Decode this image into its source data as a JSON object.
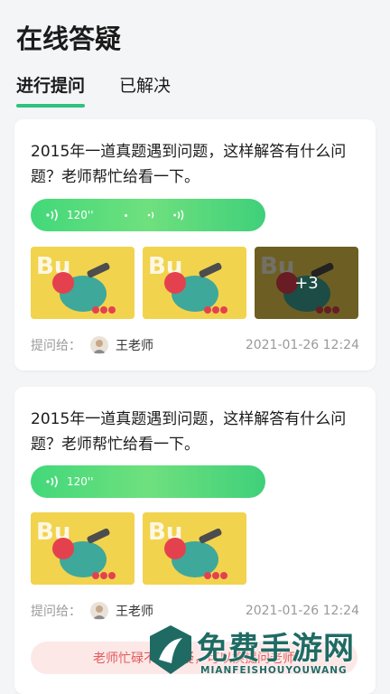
{
  "header": {
    "title": "在线答疑"
  },
  "tabs": [
    {
      "label": "进行提问",
      "active": true
    },
    {
      "label": "已解决",
      "active": false
    }
  ],
  "cards": [
    {
      "question": "2015年一道真题遇到问题，这样解答有什么问题？老师帮忙给看一下。",
      "audio_duration": "120''",
      "extra_images": "+3",
      "ask_to_label": "提问给：",
      "teacher": "王老师",
      "time": "2021-01-26 12:24"
    },
    {
      "question": "2015年一道真题遇到问题，这样解答有什么问题？老师帮忙给看一下。",
      "audio_duration": "120''",
      "ask_to_label": "提问给：",
      "teacher": "王老师",
      "time": "2021-01-26 12:24",
      "notice": "老师忙碌不能答疑，可以换提问老师"
    }
  ],
  "watermark": {
    "title": "免费手游网",
    "subtitle": "MIANFEISHOUYOUWANG"
  },
  "colors": {
    "accent": "#2ec27e",
    "notice_bg": "#fde8e8",
    "notice_text": "#e25a5a"
  }
}
